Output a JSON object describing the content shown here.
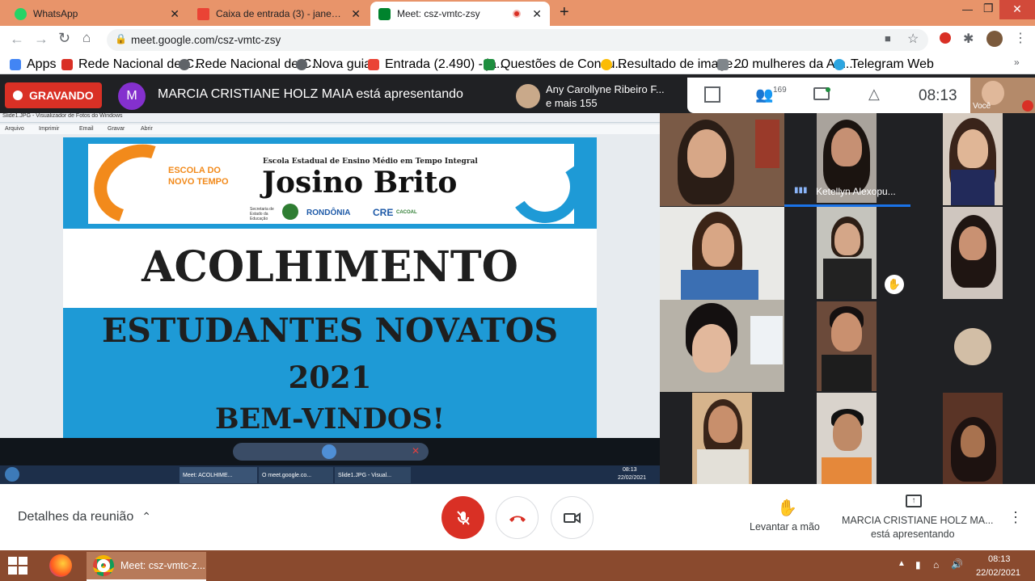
{
  "browser": {
    "tabs": [
      {
        "label": "WhatsApp",
        "icon": "whatsapp-icon",
        "active": false
      },
      {
        "label": "Caixa de entrada (3) - janemaiarb",
        "icon": "gmail-icon",
        "active": false
      },
      {
        "label": "Meet: csz-vmtc-zsy",
        "icon": "meet-icon",
        "active": true
      }
    ],
    "url": "meet.google.com/csz-vmtc-zsy",
    "bookmarks": [
      {
        "label": "Apps",
        "icon": "apps-grid-icon"
      },
      {
        "label": "Rede Nacional de C...",
        "icon": "inep-icon"
      },
      {
        "label": "Rede Nacional de C...",
        "icon": "globe-icon"
      },
      {
        "label": "Nova guia",
        "icon": "globe-icon"
      },
      {
        "label": "Entrada (2.490) - ja...",
        "icon": "gmail-icon"
      },
      {
        "label": "Questões de Concu...",
        "icon": "check-icon"
      },
      {
        "label": "Resultado de image...",
        "icon": "google-icon"
      },
      {
        "label": "20 mulheres da Am...",
        "icon": "bookmark-icon"
      },
      {
        "label": "Telegram Web",
        "icon": "telegram-icon"
      }
    ]
  },
  "meet": {
    "recording_label": "GRAVANDO",
    "presenter_initial": "M",
    "presenter_text": "MARCIA CRISTIANE HOLZ MAIA está apresentando",
    "participants_top_name": "Any Carollyne Ribeiro F...",
    "participants_top_more": "e mais 155",
    "participant_count": "169",
    "time": "08:13",
    "self_label": "Você",
    "speaker_name": "Ketellyn Alexopu...",
    "details_label": "Detalhes da reunião",
    "raise_hand_label": "Levantar a mão",
    "presenting_name": "MARCIA CRISTIANE HOLZ MA...",
    "presenting_sub": "está apresentando"
  },
  "slide": {
    "viewer_title": "Slide1.JPG - Visualizador de Fotos do Windows",
    "viewer_menu": [
      "Arquivo",
      "Imprimir",
      "Email",
      "Gravar",
      "Abrir"
    ],
    "logo_line1": "ESCOLA DO",
    "logo_line2": "NOVO TEMPO",
    "school_subtitle": "Escola Estadual de Ensino Médio em Tempo Integral",
    "school_name": "Josino Brito",
    "org1": "Secretaria de Estado da Educação",
    "org2": "RONDÔNIA",
    "org3": "CRE",
    "org3_sub": "CACOAL",
    "headline": "ACOLHIMENTO",
    "line1": "ESTUDANTES NOVATOS",
    "line2": "2021",
    "line3": "BEM-VINDOS!",
    "inner_taskbar": [
      {
        "label": "Meet: ACOLHIME..."
      },
      {
        "label": "O meet.google.co..."
      },
      {
        "label": "Slide1.JPG - Visual..."
      }
    ],
    "inner_time": "08:13",
    "inner_date": "22/02/2021"
  },
  "taskbar": {
    "window_label": "Meet: csz-vmtc-z...",
    "time": "08:13",
    "date": "22/02/2021"
  },
  "colors": {
    "tabstrip": "#e8946a",
    "recording": "#d93025",
    "slide_blue": "#1e9ad6",
    "taskbar": "#8a4a2e",
    "end_call": "#d93025"
  }
}
